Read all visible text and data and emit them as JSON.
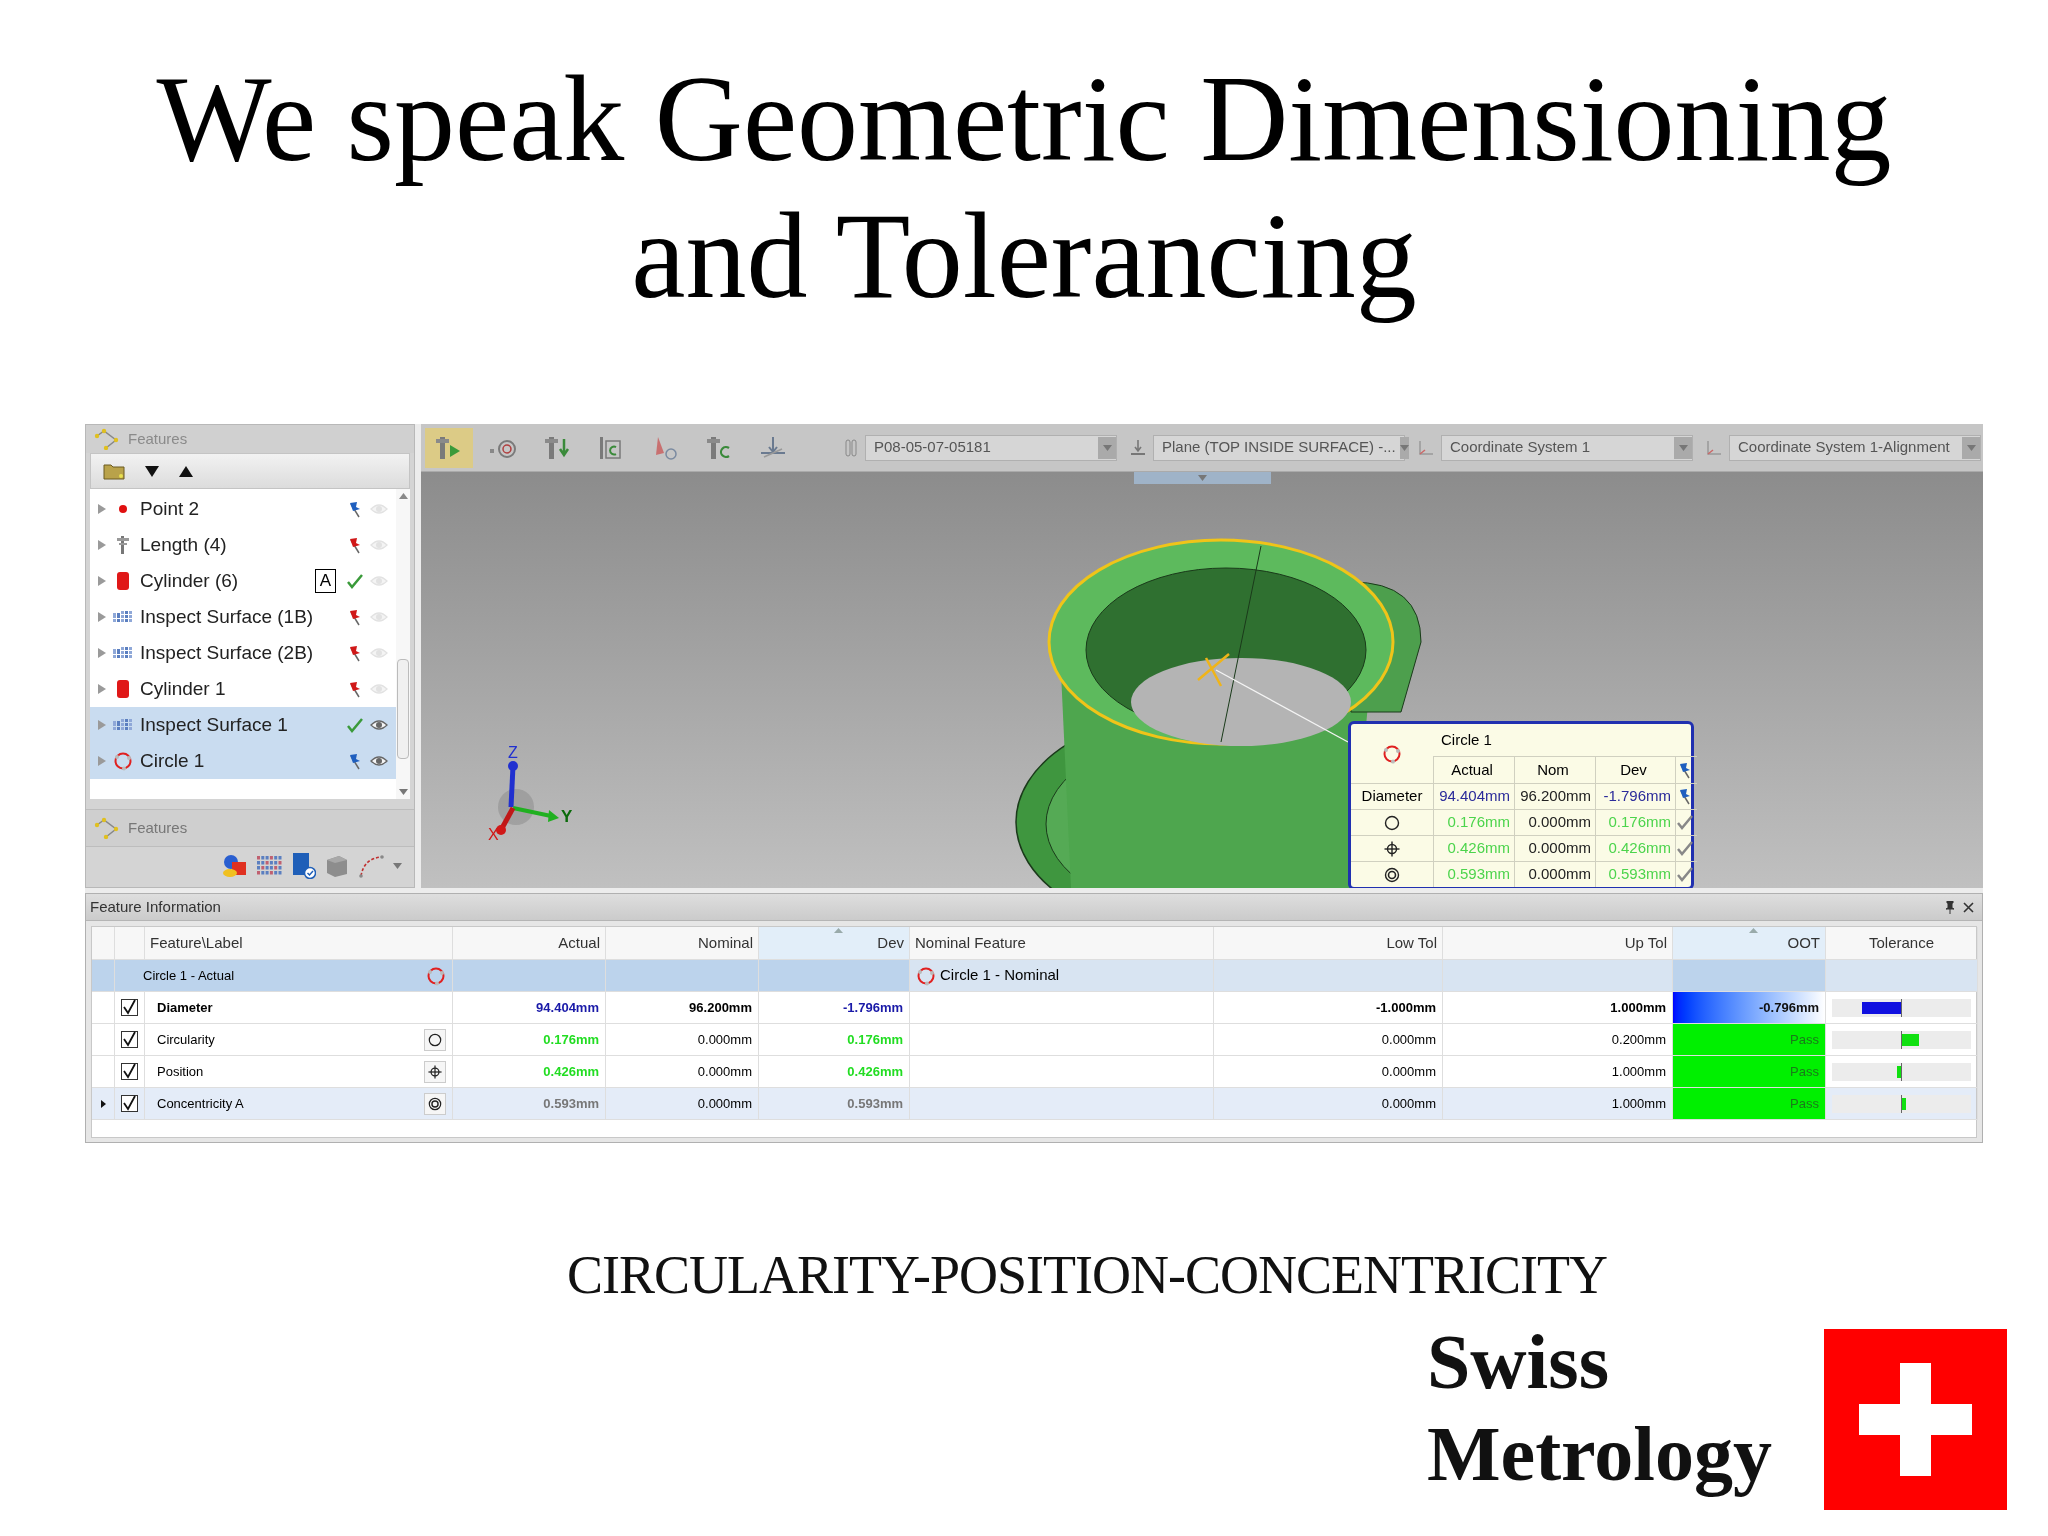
{
  "title": [
    "We speak Geometric Dimensioning",
    "and Tolerancing"
  ],
  "app": {
    "features_panel": {
      "title": "Features",
      "items": [
        {
          "label": "Point 2",
          "kind": "point",
          "passed": false,
          "color": "#1f5fbf",
          "visible": false,
          "selected": false
        },
        {
          "label": "Length (4)",
          "kind": "length",
          "passed": false,
          "color": "#d01818",
          "visible": false,
          "selected": false
        },
        {
          "label": "Cylinder (6)",
          "kind": "cylinder",
          "badge": "A",
          "passed": true,
          "visible": false,
          "selected": false
        },
        {
          "label": "Inspect Surface (1B)",
          "kind": "surface",
          "passed": false,
          "color": "#d01818",
          "visible": false,
          "selected": false
        },
        {
          "label": "Inspect Surface (2B)",
          "kind": "surface",
          "passed": false,
          "color": "#d01818",
          "visible": false,
          "selected": false
        },
        {
          "label": "Cylinder 1",
          "kind": "cylinder",
          "passed": false,
          "color": "#d01818",
          "visible": false,
          "selected": false
        },
        {
          "label": "Inspect Surface 1",
          "kind": "surface",
          "passed": true,
          "visible": true,
          "selected": true
        },
        {
          "label": "Circle 1",
          "kind": "circle",
          "passed": false,
          "color": "#1f5fbf",
          "visible": true,
          "selected": true
        }
      ],
      "footer_title": "Features"
    },
    "toolbar": {
      "tools": [
        {
          "selected": true
        },
        {
          "selected": false
        },
        {
          "selected": false
        },
        {
          "selected": false
        },
        {
          "selected": false
        },
        {
          "selected": false
        },
        {
          "selected": false
        }
      ],
      "dropdowns": [
        {
          "value": "P08-05-07-05181"
        },
        {
          "value": "Plane (TOP INSIDE SURFACE) -..."
        },
        {
          "value": "Coordinate System 1"
        },
        {
          "value": "Coordinate System 1-Alignment"
        }
      ]
    },
    "viewport": {
      "axes": {
        "z": "Z",
        "y": "Y",
        "x": "X"
      },
      "callout": {
        "title": "Circle 1",
        "columns": [
          "Actual",
          "Nom",
          "Dev"
        ],
        "color": "#1f5fbf",
        "rows": [
          {
            "label": "Diameter",
            "actual": "94.404mm",
            "nom": "96.200mm",
            "dev": "-1.796mm",
            "in_tolerance": false,
            "color": "#1f5fbf"
          },
          {
            "kind": "circularity",
            "actual": "0.176mm",
            "nom": "0.000mm",
            "dev": "0.176mm",
            "in_tolerance": true
          },
          {
            "kind": "position",
            "actual": "0.426mm",
            "nom": "0.000mm",
            "dev": "0.426mm",
            "in_tolerance": true
          },
          {
            "kind": "concentricity",
            "actual": "0.593mm",
            "nom": "0.000mm",
            "dev": "0.593mm",
            "in_tolerance": true
          }
        ]
      }
    },
    "feature_info": {
      "title": "Feature Information",
      "columns": [
        {
          "label": "Feature\\Label",
          "sorted": false
        },
        {
          "label": "Actual",
          "sorted": false
        },
        {
          "label": "Nominal",
          "sorted": false
        },
        {
          "label": "Dev",
          "sorted": true
        },
        {
          "label": "Nominal Feature",
          "sorted": false
        },
        {
          "label": "Low Tol",
          "sorted": false
        },
        {
          "label": "Up Tol",
          "sorted": false
        },
        {
          "label": "OOT",
          "sorted": true
        },
        {
          "label": "Tolerance",
          "sorted": false
        }
      ],
      "group": {
        "label": "Circle 1 - Actual",
        "nominal_feature": "Circle 1 - Nominal"
      },
      "rows": [
        {
          "label": "Diameter",
          "checked": true,
          "bold": true,
          "selected": false,
          "in_tolerance": false,
          "actual": "94.404mm",
          "nominal": "96.200mm",
          "dev": "-1.796mm",
          "low_tol": "-1.000mm",
          "up_tol": "1.000mm",
          "oot": "-0.796mm",
          "tolerance": {
            "level": 0.57,
            "negative": true
          }
        },
        {
          "label": "Circularity",
          "kind": "circularity",
          "checked": true,
          "bold": false,
          "selected": false,
          "in_tolerance": true,
          "actual": "0.176mm",
          "nominal": "0.000mm",
          "dev": "0.176mm",
          "low_tol": "0.000mm",
          "up_tol": "0.200mm",
          "oot": "Pass",
          "tolerance": {
            "level": 0.25,
            "negative": false
          }
        },
        {
          "label": "Position",
          "kind": "position",
          "checked": true,
          "bold": false,
          "selected": false,
          "in_tolerance": true,
          "actual": "0.426mm",
          "nominal": "0.000mm",
          "dev": "0.426mm",
          "low_tol": "0.000mm",
          "up_tol": "1.000mm",
          "oot": "Pass",
          "tolerance": {
            "level": 0.06,
            "negative": true
          }
        },
        {
          "label": "Concentricity A",
          "kind": "concentricity",
          "checked": true,
          "bold": false,
          "selected": true,
          "in_tolerance": true,
          "actual": "0.593mm",
          "nominal": "0.000mm",
          "dev": "0.593mm",
          "low_tol": "0.000mm",
          "up_tol": "1.000mm",
          "oot": "Pass",
          "tolerance": {
            "level": 0.06,
            "negative": false
          }
        }
      ]
    }
  },
  "subtitle": "CIRCULARITY-POSITION-CONCENTRICITY",
  "logo": {
    "lines": [
      "Swiss",
      "Metrology"
    ]
  }
}
